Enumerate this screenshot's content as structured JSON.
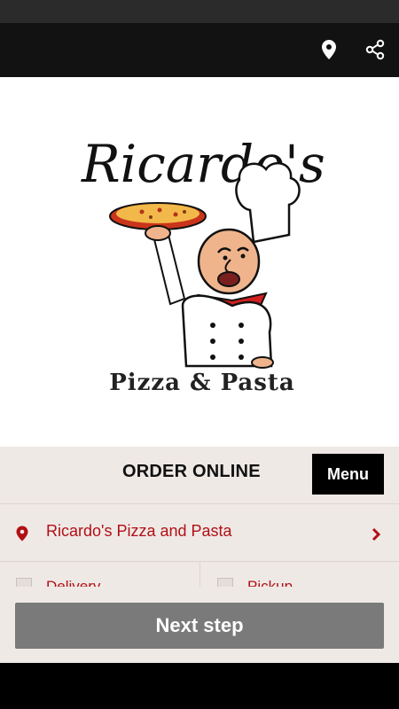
{
  "toolbar": {
    "location_icon": "location-pin-icon",
    "share_icon": "share-icon"
  },
  "logo": {
    "script_text": "Ricardo's",
    "subtitle": "Pizza & Pasta"
  },
  "order": {
    "title": "ORDER ONLINE",
    "menu_label": "Menu"
  },
  "location": {
    "name": "Ricardo's Pizza and Pasta"
  },
  "options": [
    {
      "label": "Delivery"
    },
    {
      "label": "Pickup"
    }
  ],
  "footer": {
    "next_label": "Next step"
  },
  "colors": {
    "accent_red": "#b01015",
    "button_gray": "#7a7a7a",
    "panel_bg": "#efe9e6"
  }
}
